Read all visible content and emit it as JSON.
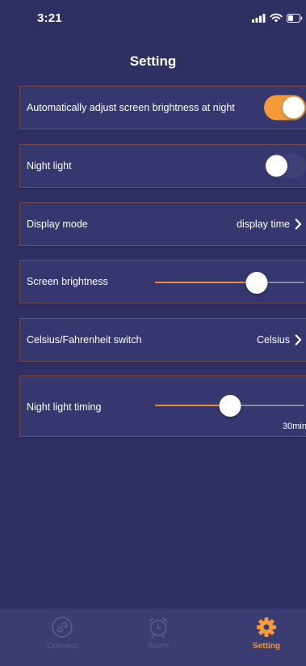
{
  "status": {
    "time": "3:21"
  },
  "header": {
    "title": "Setting"
  },
  "settings": {
    "auto_brightness": {
      "label": "Automatically adjust screen brightness at night",
      "enabled": true
    },
    "night_light": {
      "label": "Night light",
      "enabled": false
    },
    "display_mode": {
      "label": "Display mode",
      "value": "display time"
    },
    "screen_brightness": {
      "label": "Screen brightness",
      "level": 0.68
    },
    "temp_unit": {
      "label": "Celsius/Fahrenheit switch",
      "value": "Celsius"
    },
    "night_light_timing": {
      "label": "Night light timing",
      "level": 0.5,
      "value": "30min"
    }
  },
  "tabs": [
    {
      "label": "Connect",
      "icon": "link-icon",
      "active": false
    },
    {
      "label": "Alarm",
      "icon": "alarm-clock-icon",
      "active": false
    },
    {
      "label": "Setting",
      "icon": "gear-icon",
      "active": true
    }
  ],
  "colors": {
    "background": "#2e2f63",
    "card": "#35376e",
    "accent": "#f39a3a",
    "tab_inactive": "#5b5e8c"
  }
}
